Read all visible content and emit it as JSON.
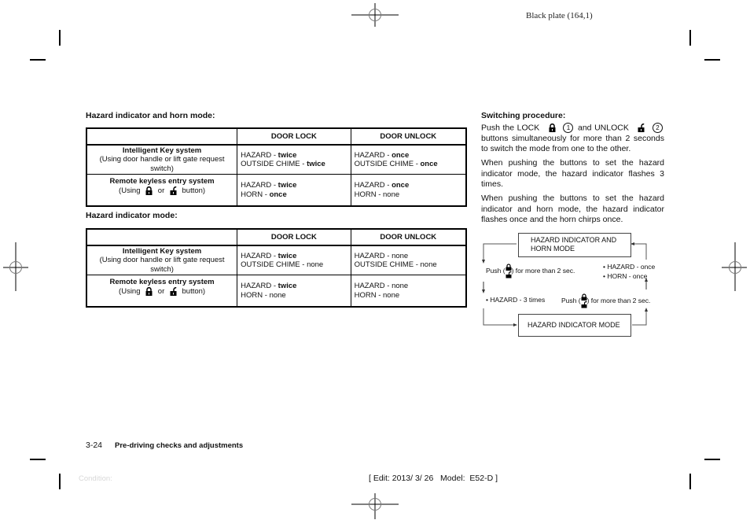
{
  "header": {
    "plate": "Black plate (164,1)"
  },
  "section1": {
    "heading": "Hazard indicator and horn mode:",
    "columns": [
      "",
      "DOOR LOCK",
      "DOOR UNLOCK"
    ],
    "rows": [
      {
        "system_title": "Intelligent Key system",
        "system_note": "(Using door handle or lift gate request switch)",
        "lock": {
          "line1_label": "HAZARD - ",
          "line1_value": "twice",
          "line2_label": "OUTSIDE CHIME - ",
          "line2_value": "twice"
        },
        "unlock": {
          "line1_label": "HAZARD - ",
          "line1_value": "once",
          "line2_label": "OUTSIDE CHIME - ",
          "line2_value": "once"
        }
      },
      {
        "system_title": "Remote keyless entry system",
        "note_prefix": "(Using",
        "note_or": "or",
        "note_suffix": "button)",
        "lock": {
          "line1_label": "HAZARD - ",
          "line1_value": "twice",
          "line2_label": "HORN - ",
          "line2_value": "once"
        },
        "unlock": {
          "line1_label": "HAZARD - ",
          "line1_value": "once",
          "line2_label": "HORN - ",
          "line2_value": "none"
        }
      }
    ]
  },
  "section2": {
    "heading": "Hazard indicator mode:",
    "columns": [
      "",
      "DOOR LOCK",
      "DOOR UNLOCK"
    ],
    "rows": [
      {
        "system_title": "Intelligent Key system",
        "system_note": "(Using door handle or lift gate request switch)",
        "lock": {
          "line1_label": "HAZARD - ",
          "line1_value": "twice",
          "line2_label": "OUTSIDE CHIME - ",
          "line2_value": "none"
        },
        "unlock": {
          "line1_label": "HAZARD - ",
          "line1_value": "none",
          "line2_label": "OUTSIDE CHIME - ",
          "line2_value": "none"
        }
      },
      {
        "system_title": "Remote keyless entry system",
        "note_prefix": "(Using",
        "note_or": "or",
        "note_suffix": "button)",
        "lock": {
          "line1_label": "HAZARD - ",
          "line1_value": "twice",
          "line2_label": "HORN - ",
          "line2_value": "none"
        },
        "unlock": {
          "line1_label": "HAZARD - ",
          "line1_value": "none",
          "line2_label": "HORN - ",
          "line2_value": "none"
        }
      }
    ]
  },
  "switching": {
    "heading": "Switching procedure:",
    "p1_a": "Push the LOCK",
    "p1_num1": "1",
    "p1_b": "and UNLOCK",
    "p1_num2": "2",
    "p1_c": "buttons simultaneously for more than 2 seconds to switch the mode from one to the other.",
    "p2": "When pushing the buttons to set the hazard indicator mode, the hazard indicator flashes 3 times.",
    "p3": "When pushing the buttons to set the hazard indicator and horn mode, the hazard indicator flashes once and the horn chirps once."
  },
  "diagram": {
    "box_top_line1": "HAZARD INDICATOR AND",
    "box_top_line2": "HORN MODE",
    "box_bottom": "HAZARD INDICATOR MODE",
    "push_left_a": "Push (",
    "push_left_b": ") for more than 2 sec.",
    "push_right_a": "Push (",
    "push_right_b": ") for more than 2 sec.",
    "result_left": "• HAZARD - 3 times",
    "result_right_1": "• HAZARD - once",
    "result_right_2": "• HORN - once"
  },
  "footer": {
    "page_number": "3-24",
    "chapter_title": "Pre-driving checks and adjustments",
    "condition": "Condition:",
    "edit_info": "[ Edit: 2013/ 3/ 26   Model:  E52-D ]"
  }
}
